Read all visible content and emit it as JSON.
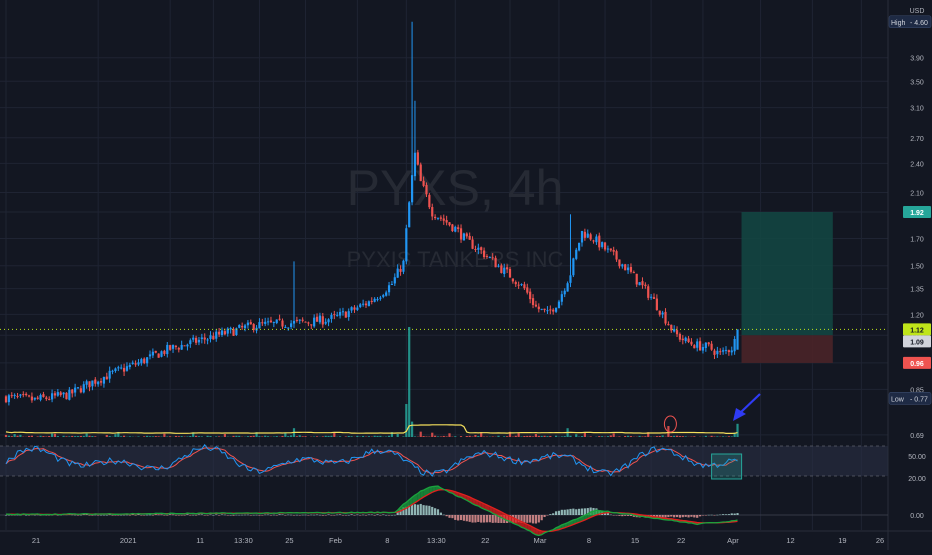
{
  "header": {
    "currency": "USD"
  },
  "watermark": {
    "symbol": "PYXS, 4h",
    "company": "PYXIS TANKERS INC"
  },
  "colors": {
    "background": "#131722",
    "grid": "#1f2433",
    "axis_text": "#b2b5be",
    "up": "#2196f3",
    "down": "#ef5350",
    "wick": "#c3c6ce",
    "volume_up": "#26a69a",
    "volume_down": "#ef5350",
    "volume_ma": "#f5e05c",
    "stoch_k": "#2196f3",
    "stoch_d": "#ef5350",
    "macd_green": "#1aa33d",
    "macd_red": "#e0201e",
    "target_zone": "#134843",
    "stop_zone": "#4a2428",
    "current_line": "#bfe51a",
    "arrow": "#2f3bf5"
  },
  "chart_data": [
    {
      "type": "candlestick",
      "panel": "price",
      "scale": "log",
      "ylim": [
        0.68,
        4.9
      ],
      "y_ticks": [
        "0.69",
        "0.85",
        "0.96",
        "1.09",
        "1.20",
        "1.35",
        "1.50",
        "1.70",
        "1.92",
        "2.10",
        "2.40",
        "2.70",
        "3.10",
        "3.50",
        "3.90"
      ],
      "x_ticks": [
        "21",
        "2021",
        "11",
        "13:30",
        "25",
        "Feb",
        "8",
        "13:30",
        "22",
        "Mar",
        "8",
        "15",
        "22",
        "Apr",
        "12",
        "19",
        "26"
      ],
      "x_tick_index": [
        0,
        32,
        57,
        72,
        88,
        104,
        122,
        139,
        156,
        175,
        192,
        208,
        224,
        242,
        262,
        280,
        297
      ],
      "bar_count": 310,
      "candles_visible": 255,
      "markers": [
        {
          "label": "High",
          "value": "4.60"
        },
        {
          "label": "Low",
          "value": "0.77"
        }
      ],
      "price_labels": [
        {
          "value": "1.92",
          "role": "target"
        },
        {
          "value": "1.12",
          "role": "current"
        },
        {
          "value": "1.09",
          "role": "entry"
        },
        {
          "value": "0.96",
          "role": "stop"
        }
      ],
      "position_tool": {
        "type": "long",
        "entry": 1.09,
        "target": 1.92,
        "stop": 0.96,
        "start_index": 254,
        "end_index": 285
      },
      "current_price": 1.12,
      "anchors": [
        [
          0,
          0.82
        ],
        [
          10,
          0.81
        ],
        [
          22,
          0.83
        ],
        [
          30,
          0.88
        ],
        [
          38,
          0.92
        ],
        [
          46,
          0.96
        ],
        [
          56,
          1.02
        ],
        [
          66,
          1.06
        ],
        [
          76,
          1.1
        ],
        [
          86,
          1.14
        ],
        [
          96,
          1.15
        ],
        [
          106,
          1.16
        ],
        [
          114,
          1.18
        ],
        [
          120,
          1.22
        ],
        [
          126,
          1.27
        ],
        [
          130,
          1.32
        ],
        [
          134,
          1.38
        ],
        [
          138,
          1.52
        ],
        [
          140,
          2.0
        ],
        [
          142,
          2.5
        ],
        [
          144,
          2.2
        ],
        [
          148,
          1.92
        ],
        [
          152,
          1.85
        ],
        [
          156,
          1.78
        ],
        [
          160,
          1.68
        ],
        [
          164,
          1.62
        ],
        [
          168,
          1.55
        ],
        [
          172,
          1.48
        ],
        [
          176,
          1.42
        ],
        [
          180,
          1.35
        ],
        [
          184,
          1.24
        ],
        [
          188,
          1.2
        ],
        [
          192,
          1.28
        ],
        [
          196,
          1.45
        ],
        [
          200,
          1.75
        ],
        [
          204,
          1.7
        ],
        [
          208,
          1.62
        ],
        [
          212,
          1.55
        ],
        [
          216,
          1.47
        ],
        [
          220,
          1.38
        ],
        [
          224,
          1.3
        ],
        [
          228,
          1.2
        ],
        [
          232,
          1.1
        ],
        [
          236,
          1.06
        ],
        [
          240,
          1.04
        ],
        [
          244,
          1.03
        ],
        [
          248,
          1.0
        ],
        [
          252,
          1.03
        ],
        [
          254,
          1.09
        ]
      ],
      "spikes": [
        {
          "index": 100,
          "high": 1.53
        },
        {
          "index": 141,
          "high": 4.6
        },
        {
          "index": 142,
          "high": 3.2
        },
        {
          "index": 196,
          "high": 1.9
        }
      ]
    },
    {
      "type": "bar",
      "panel": "volume",
      "label": "",
      "spikes": [
        {
          "index": 140,
          "value": 100
        },
        {
          "index": 139,
          "value": 30
        },
        {
          "index": 141,
          "value": 14
        },
        {
          "index": 100,
          "value": 8
        },
        {
          "index": 230,
          "value": 10
        },
        {
          "index": 195,
          "value": 8
        },
        {
          "index": 254,
          "value": 12
        }
      ]
    },
    {
      "type": "line",
      "panel": "stochastic",
      "y_ticks": [
        "50.00",
        "20.00"
      ],
      "bands": [
        80,
        20
      ],
      "series": [
        {
          "role": "k"
        },
        {
          "role": "d"
        }
      ]
    },
    {
      "type": "area",
      "panel": "macd",
      "y_ticks": [
        "0.00"
      ],
      "series": [
        {
          "role": "macd"
        },
        {
          "role": "signal"
        },
        {
          "role": "histogram"
        }
      ]
    }
  ]
}
